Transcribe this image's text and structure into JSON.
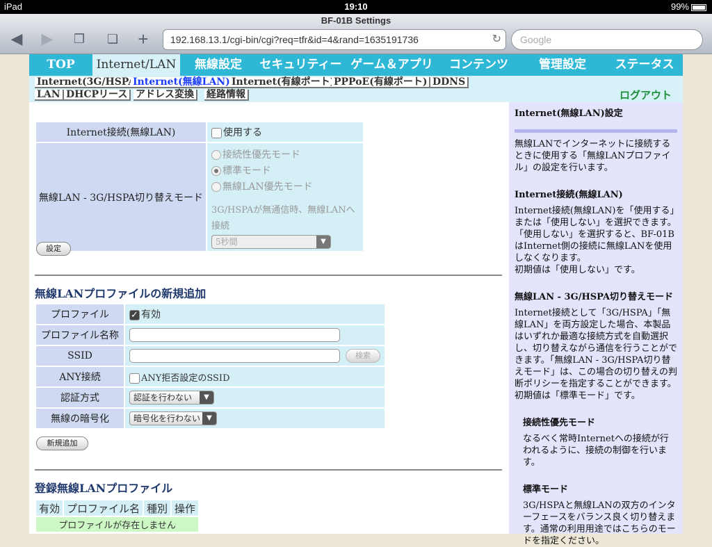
{
  "status_bar": {
    "device": "iPad",
    "time": "19:10",
    "battery": "99%"
  },
  "browser": {
    "page_title": "BF-01B Settings",
    "url": "192.168.13.1/cgi-bin/cgi?req=tfr&id=4&rand=1635191736",
    "search_placeholder": "Google"
  },
  "nav": {
    "tabs": [
      "TOP",
      "Internet/LAN",
      "無線設定",
      "セキュリティー",
      "ゲーム＆アプリ",
      "コンテンツ",
      "管理設定",
      "ステータス"
    ],
    "active_tab": "Internet/LAN",
    "subtabs_row1": [
      "Internet(3G/HSPA)",
      "Internet(無線LAN)",
      "Internet(有線ポート)",
      "PPPoE(有線ポート)",
      "DDNS"
    ],
    "subtabs_row2": [
      "LAN",
      "DHCPリース",
      "アドレス変換",
      "経路情報"
    ],
    "active_subtab": "Internet(無線LAN)",
    "logout": "ログアウト"
  },
  "connection": {
    "label_internet": "Internet接続(無線LAN)",
    "use_label": "使用する",
    "label_mode": "無線LAN - 3G/HSPA切り替えモード",
    "modes": [
      "接続性優先モード",
      "標準モード",
      "無線LAN優先モード"
    ],
    "selected_mode": "標準モード",
    "fallback_label": "3G/HSPAが無通信時、無線LANへ接続",
    "fallback_value": "5秒間",
    "submit": "設定"
  },
  "new_profile": {
    "heading": "無線LANプロファイルの新規追加",
    "rows": {
      "profile": "プロファイル",
      "profile_name": "プロファイル名称",
      "ssid": "SSID",
      "any": "ANY接続",
      "auth": "認証方式",
      "encryption": "無線の暗号化"
    },
    "enabled_label": "有効",
    "search_button": "検索",
    "any_option": "ANY拒否設定のSSID",
    "auth_value": "認証を行わない",
    "encryption_value": "暗号化を行わない",
    "add_button": "新規追加"
  },
  "registered": {
    "heading": "登録無線LANプロファイル",
    "columns": [
      "有効",
      "プロファイル名",
      "種別",
      "操作"
    ],
    "empty_message": "プロファイルが存在しません"
  },
  "help": {
    "title": "Internet(無線LAN)設定",
    "intro": "無線LANでインターネットに接続するときに使用する「無線LANプロファイル」の設定を行います。",
    "s1_title": "Internet接続(無線LAN)",
    "s1_text": "Internet接続(無線LAN)を「使用する」または「使用しない」を選択できます。「使用しない」を選択すると、BF-01BはInternet側の接続に無線LANを使用しなくなります。",
    "s1_default": "初期値は「使用しない」です。",
    "s2_title": "無線LAN - 3G/HSPA切り替えモード",
    "s2_text": "Internet接続として「3G/HSPA」「無線LAN」を両方設定した場合、本製品はいずれか最適な接続方式を自動選択し、切り替えながら通信を行うことができます。「無線LAN - 3G/HSPA切り替えモード」は、この場合の切り替えの判断ポリシーを指定することができます。",
    "s2_default": "初期値は「標準モード」です。",
    "s3_title": "接続性優先モード",
    "s3_text": "なるべく常時Internetへの接続が行われるように、接続の制御を行います。",
    "s4_title": "標準モード",
    "s4_text": "3G/HSPAと無線LANの双方のインターフェースをバランス良く切り替えます。通常の利用用途ではこちらのモードを指定ください。"
  }
}
